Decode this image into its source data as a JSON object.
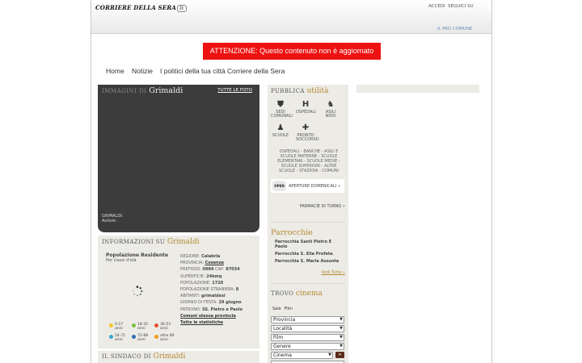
{
  "header": {
    "logo": "CORRIERE DELLA SERA",
    "logo_badge": "it",
    "links": {
      "accedi": "ACCEDI",
      "seguici": "SEGUICI SU",
      "mio_comune": "IL MIO COMUNE"
    }
  },
  "alert": "ATTENZIONE: Questo contenuto non è aggiornato",
  "nav": [
    "Home",
    "Notizie",
    "I politici della tua città",
    "Corriere della Sera"
  ],
  "gallery": {
    "title_prefix": "IMMAGINI DI",
    "title_name": "Grimaldi",
    "all_photos": "TUTTE LE FOTO",
    "caption_name": "GRIMALDI:",
    "caption_author": "Autore:"
  },
  "info": {
    "heading_prefix": "INFORMAZIONI SU",
    "heading_name": "Grimaldi",
    "population_title": "Popolazione Residente",
    "population_subtitle": "Per classi d'età",
    "legend": [
      {
        "label": "0-17 anni",
        "color": "#f4c430"
      },
      {
        "label": "18-35 anni",
        "color": "#7cc242"
      },
      {
        "label": "36-53 anni",
        "color": "#e8502d"
      },
      {
        "label": "54-71 anni",
        "color": "#3ba6d8"
      },
      {
        "label": "72-88 anni",
        "color": "#2f6db3"
      },
      {
        "label": "oltre 89 anni",
        "color": "#f39c12"
      }
    ],
    "facts": [
      {
        "label": "REGIONE:",
        "value": "Calabria"
      },
      {
        "label": "PROVINCIA:",
        "value": "Cosenza"
      },
      {
        "label": "PREFISSO:",
        "value": "0984",
        "label2": "CAP:",
        "value2": "87034"
      },
      {
        "label": "SUPERFICIE:",
        "value": "24kmq"
      },
      {
        "label": "POPOLAZIONE:",
        "value": "1720"
      },
      {
        "label": "POPOLAZIONE STRANIERA:",
        "value": "8"
      },
      {
        "label": "ABITANTI:",
        "value": "grimaldesi"
      },
      {
        "label": "GIORNO DI FESTA:",
        "value": "29 giugno"
      },
      {
        "label": "PATRONO:",
        "value": "SS. Pietro e Paolo"
      }
    ],
    "link_same_province": "Comuni stessa provincia",
    "link_all_stats": "Tutte le statistiche"
  },
  "sindaco": {
    "prefix": "IL SINDACO DI",
    "name": "Grimaldi"
  },
  "public": {
    "heading_prefix": "PUBBLICA",
    "heading_name": "utilità",
    "icons": [
      {
        "name": "sedi-comunali-icon",
        "label": "SEDI COMUNALI",
        "glyph": "⛊"
      },
      {
        "name": "ospedali-icon",
        "label": "OSPEDALI",
        "glyph": "H"
      },
      {
        "name": "asili-nido-icon",
        "label": "ASILI NIDO",
        "glyph": "♞"
      },
      {
        "name": "scuole-icon",
        "label": "SCUOLE",
        "glyph": "♟"
      },
      {
        "name": "pronto-soccorso-icon",
        "label": "PRONTO SOCCORSO",
        "glyph": "✚"
      }
    ],
    "text": "OSPEDALI - BANCHE - ASILI E SCUOLE MATERNE - SCUOLE ELEMENTARI - SCUOLE MEDIE - SCUOLE SUPERIORI - ALTRE SCUOLE - STAZIONI - COMUNI",
    "open_badge": "OPEN",
    "open_label": "APERTURE DOMENICALI »",
    "farmacie": "FARMACIE DI TURNO »"
  },
  "parrocchie": {
    "heading": "Parrocchie",
    "items": [
      "Parrocchia Santi Pietro E Paolo",
      "Parrocchia S. Elia Profeta",
      "Parrocchia S. Maria Assunta"
    ],
    "all": "Vedi Tutte »"
  },
  "cinema": {
    "heading_prefix": "TROVO",
    "heading_name": "cinema",
    "tabs": [
      "Sale",
      "Film"
    ],
    "selects": [
      "Provincia",
      "Località",
      "Film",
      "Genere",
      "Cinema"
    ],
    "go": "»"
  }
}
